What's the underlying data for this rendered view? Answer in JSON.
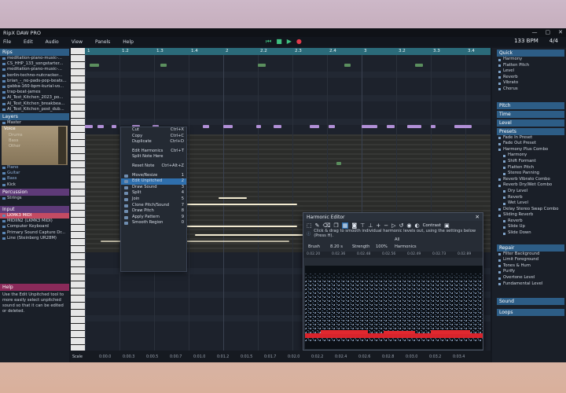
{
  "app": {
    "title": "RipX DAW PRO",
    "window_controls": [
      "—",
      "▢",
      "✕"
    ]
  },
  "menu": [
    "File",
    "Edit",
    "Audio",
    "View",
    "Panels",
    "Help"
  ],
  "transport": {
    "tempo": "133 BPM",
    "time_sig": "4/4"
  },
  "left_panel": {
    "rips_title": "Rips",
    "rips": [
      "meditation-piano-music-...",
      "CS_HHP_133_songstarter...",
      "meditation-piano-music-...",
      "berlin-techno-nutcracker...",
      "brian_-_no-pads-pop-beats...",
      "gabba-160-bpm-kurial-vo...",
      "trap-beat-james",
      "AI_Test_Kitchen_2023_po...",
      "AI_Test_Kitchen_breakbea...",
      "AI_Test_Kitchen_post_dub..."
    ],
    "layers_title": "Layers",
    "layers": [
      "Master",
      "Voice"
    ],
    "voice_items": [
      "Drums",
      "Bass",
      "Other",
      "Piano",
      "Guitar",
      "Bass",
      "Kick"
    ],
    "percussion_title": "Percussion",
    "percussion": [
      "Strings"
    ],
    "input_title": "Input",
    "inputs": [
      "LKMK3 MIDI",
      "MIDIIN2 (LKMK3 MIDI)",
      "Computer Keyboard",
      "Primary Sound Capture Dr...",
      "Line (Steinberg UR28M)"
    ],
    "help_title": "Help",
    "help_text": "Use the Edit Unpitched tool to more easily select unpitched sound so that it can be edited or deleted."
  },
  "ruler": [
    "1",
    "1.2",
    "1.3",
    "1.4",
    "2",
    "2.2",
    "2.3",
    "2.4",
    "3",
    "3.2",
    "3.3",
    "3.4"
  ],
  "context_menu": [
    {
      "label": "Cut",
      "key": "Ctrl+X"
    },
    {
      "label": "Copy",
      "key": "Ctrl+C"
    },
    {
      "label": "Duplicate",
      "key": "Ctrl+D"
    },
    {
      "label": "Edit Harmonics",
      "key": "Ctrl+T"
    },
    {
      "label": "Split Note Here",
      "key": ""
    },
    {
      "label": "Reset Note",
      "key": "Ctrl+Alt+Z"
    },
    {
      "label": "Move/Resize",
      "key": "1"
    },
    {
      "label": "Edit Unpitched",
      "key": "2"
    },
    {
      "label": "Draw Sound",
      "key": "3"
    },
    {
      "label": "Split",
      "key": "4"
    },
    {
      "label": "Join",
      "key": "5"
    },
    {
      "label": "Clone Pitch/Sound",
      "key": "7"
    },
    {
      "label": "Draw Pitch",
      "key": "8"
    },
    {
      "label": "Apply Pattern",
      "key": "9"
    },
    {
      "label": "Smooth Region",
      "key": "0"
    }
  ],
  "harmonic_editor": {
    "title": "Harmonic Editor",
    "info": "Click & drag to smooth individual harmonic levels out, using the settings below (Press H).",
    "brush_label": "Brush",
    "brush_value": "8.20 s",
    "strength_label": "Strength",
    "strength_value": "100%",
    "harmonics_label": "Harmonics",
    "harmonics_value": "All",
    "contrast_label": "Contrast",
    "ticks": [
      "0.02.20",
      "0.02.36",
      "0.02.48",
      "0.02.56",
      "0.02.49",
      "0.02.73",
      "0.02.89"
    ]
  },
  "right_panel": {
    "quick_title": "Quick",
    "quick": [
      "Harmony",
      "Flatten Pitch",
      "Level",
      "Reverb",
      "Vibrato",
      "Chorus"
    ],
    "pitch_title": "Pitch",
    "time_title": "Time",
    "level_title": "Level",
    "presets_title": "Presets",
    "presets": [
      {
        "label": "Fade In Preset",
        "sub": false
      },
      {
        "label": "Fade Out Preset",
        "sub": false
      },
      {
        "label": "Harmony Plus Combo",
        "sub": false
      },
      {
        "label": "Harmony",
        "sub": true
      },
      {
        "label": "Shift Formant",
        "sub": true
      },
      {
        "label": "Flatten Pitch",
        "sub": true
      },
      {
        "label": "Stereo Panning",
        "sub": true
      },
      {
        "label": "Reverb Vibrato Combo",
        "sub": false
      },
      {
        "label": "Reverb Dry/Wet Combo",
        "sub": false
      },
      {
        "label": "Dry Level",
        "sub": true
      },
      {
        "label": "Reverb",
        "sub": true
      },
      {
        "label": "Wet Level",
        "sub": true
      },
      {
        "label": "Delay Stereo Swap Combo",
        "sub": false
      },
      {
        "label": "Sliding Reverb",
        "sub": false
      },
      {
        "label": "Reverb",
        "sub": true
      },
      {
        "label": "Slide Up",
        "sub": true
      },
      {
        "label": "Slide Down",
        "sub": true
      }
    ],
    "repair_title": "Repair",
    "repair": [
      "Filter Background",
      "Limit Foreground",
      "Tones & Hum",
      "Purify",
      "Overtone Level",
      "Fundamental Level"
    ],
    "sound_title": "Sound",
    "loops_title": "Loops"
  },
  "bottom": {
    "scale_label": "Scale",
    "ticks": [
      "0:00.0",
      "0:00.3",
      "0:00.5",
      "0:00.7",
      "0:01.0",
      "0:01.2",
      "0:01.5",
      "0:01.7",
      "0:02.0",
      "0:02.2",
      "0:02.4",
      "0:02.6",
      "0:02.8",
      "0:03.0",
      "0:03.2",
      "0:03.4"
    ]
  }
}
